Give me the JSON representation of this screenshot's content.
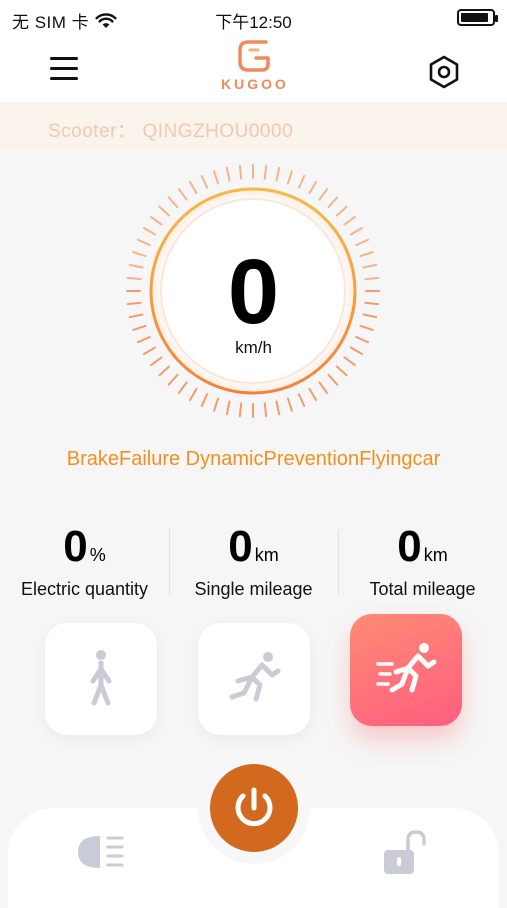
{
  "status_bar": {
    "carrier": "无 SIM 卡",
    "time": "下午12:50",
    "battery_level": 0.9
  },
  "header": {
    "brand": "KUGOO",
    "menu_icon": "hamburger-menu-icon",
    "settings_icon": "hexagon-settings-icon"
  },
  "scooter": {
    "label": "Scooter：",
    "name": "QINGZHOU0000"
  },
  "speedometer": {
    "value": "0",
    "unit": "km/h",
    "ring_color": "#f5a623"
  },
  "mode_text": "BrakeFailure DynamicPreventionFlyingcar",
  "stats": [
    {
      "value": "0",
      "unit": "%",
      "label": "Electric quantity"
    },
    {
      "value": "0",
      "unit": "km",
      "label": "Single mileage"
    },
    {
      "value": "0",
      "unit": "km",
      "label": "Total mileage"
    }
  ],
  "speed_modes": [
    {
      "name": "walk",
      "icon": "walking-person-icon",
      "active": false
    },
    {
      "name": "run",
      "icon": "running-person-icon",
      "active": false
    },
    {
      "name": "sprint",
      "icon": "sprinting-person-icon",
      "active": true
    }
  ],
  "bottom_bar": {
    "light_icon": "headlight-icon",
    "power_icon": "power-icon",
    "lock_icon": "unlocked-padlock-icon"
  },
  "colors": {
    "accent_orange": "#f0901e",
    "power_button": "#d2691e",
    "active_mode_gradient_start": "#ff8b74",
    "active_mode_gradient_end": "#ff5e7f",
    "banner_text": "#f3c6b3"
  }
}
